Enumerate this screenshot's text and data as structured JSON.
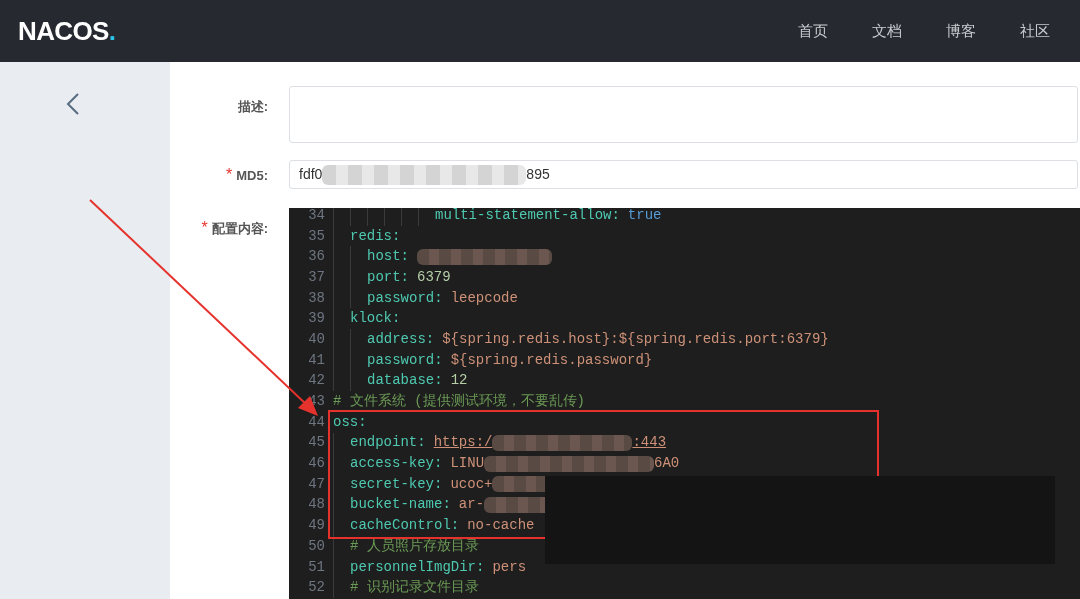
{
  "header": {
    "logo": {
      "text": "NACOS",
      "dot": "."
    },
    "nav": [
      "首页",
      "文档",
      "博客",
      "社区"
    ]
  },
  "form": {
    "description": {
      "label": "描述:"
    },
    "md5": {
      "label": "MD5:",
      "required_mark": "*",
      "value": [
        {
          "kind": "text",
          "text": "fdf0"
        },
        {
          "kind": "redacted"
        },
        {
          "kind": "text",
          "text": "895"
        }
      ]
    },
    "content": {
      "label": "配置内容:",
      "required_mark": "*",
      "lines": [
        {
          "children": [
            {
              "children": [
                {
                  "children": [
                    {
                      "children": [
                        {
                          "children": [
                            {
                              "children": [
                                {
                                  "number": "34",
                                  "key": "multi-statement-allow:",
                                  "value": [
                                    {
                                      "kind": "bool",
                                      "text": "true"
                                    }
                                  ]
                                }
                              ]
                            }
                          ]
                        }
                      ]
                    }
                  ]
                }
              ]
            },
            {
              "number": "35",
              "key": "redis:",
              "children": [
                {
                  "number": "36",
                  "key": "host:",
                  "value": [
                    {
                      "kind": "redacted"
                    }
                  ]
                },
                {
                  "number": "37",
                  "key": "port:",
                  "value": [
                    {
                      "kind": "number",
                      "text": "6379"
                    }
                  ]
                },
                {
                  "number": "38",
                  "key": "password:",
                  "value": [
                    {
                      "kind": "string",
                      "text": "leepcode"
                    }
                  ]
                }
              ]
            },
            {
              "number": "39",
              "key": "klock:",
              "children": [
                {
                  "number": "40",
                  "key": "address:",
                  "value": [
                    {
                      "kind": "string",
                      "text": "${spring.redis.host}:${spring.redis.port:6379}"
                    }
                  ]
                },
                {
                  "number": "41",
                  "key": "password:",
                  "value": [
                    {
                      "kind": "string",
                      "text": "${spring.redis.password}"
                    }
                  ]
                },
                {
                  "number": "42",
                  "key": "database:",
                  "value": [
                    {
                      "kind": "number",
                      "text": "12"
                    }
                  ]
                }
              ]
            }
          ]
        },
        {
          "number": "43",
          "comment": "# 文件系统 (提供测试环境，不要乱传)"
        },
        {
          "number": "44",
          "key": "oss:",
          "children": [
            {
              "number": "45",
              "key": "endpoint:",
              "value": [
                {
                  "kind": "link",
                  "text": "https:/"
                },
                {
                  "kind": "redacted"
                },
                {
                  "kind": "link",
                  "text": ":443"
                }
              ]
            },
            {
              "number": "46",
              "key": "access-key:",
              "value": [
                {
                  "kind": "string",
                  "text": "LINU"
                },
                {
                  "kind": "redacted"
                },
                {
                  "kind": "string",
                  "text": "6A0"
                }
              ]
            },
            {
              "number": "47",
              "key": "secret-key:",
              "value": [
                {
                  "kind": "string",
                  "text": "ucoc+"
                },
                {
                  "kind": "redacted"
                }
              ]
            },
            {
              "number": "48",
              "key": "bucket-name:",
              "value": [
                {
                  "kind": "string",
                  "text": "ar-"
                },
                {
                  "kind": "redacted"
                }
              ]
            },
            {
              "number": "49",
              "key": "cacheControl:",
              "value": [
                {
                  "kind": "string",
                  "text": "no-cache"
                }
              ]
            },
            {
              "number": "50",
              "comment": "# 人员照片存放目录"
            },
            {
              "number": "51",
              "key": "personnelImgDir:",
              "value": [
                {
                  "kind": "string",
                  "text": "pers"
                }
              ]
            },
            {
              "number": "52",
              "comment": "# 识别记录文件目录"
            }
          ]
        }
      ]
    }
  }
}
